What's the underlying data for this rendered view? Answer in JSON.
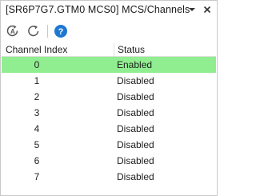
{
  "window": {
    "title": "[SR6P7G7.GTM0 MCS0] MCS/Channels"
  },
  "toolbar": {
    "buttons": [
      {
        "icon": "auto-refresh-icon"
      },
      {
        "icon": "refresh-icon"
      },
      {
        "icon": "help-icon"
      }
    ]
  },
  "table": {
    "headers": {
      "index": "Channel Index",
      "status": "Status"
    },
    "rows": [
      {
        "index": "0",
        "status": "Enabled",
        "selected": true
      },
      {
        "index": "1",
        "status": "Disabled"
      },
      {
        "index": "2",
        "status": "Disabled"
      },
      {
        "index": "3",
        "status": "Disabled"
      },
      {
        "index": "4",
        "status": "Disabled"
      },
      {
        "index": "5",
        "status": "Disabled"
      },
      {
        "index": "6",
        "status": "Disabled"
      },
      {
        "index": "7",
        "status": "Disabled"
      }
    ]
  },
  "colors": {
    "selected_row": "#90ee90",
    "help_icon": "#1e78d2"
  }
}
